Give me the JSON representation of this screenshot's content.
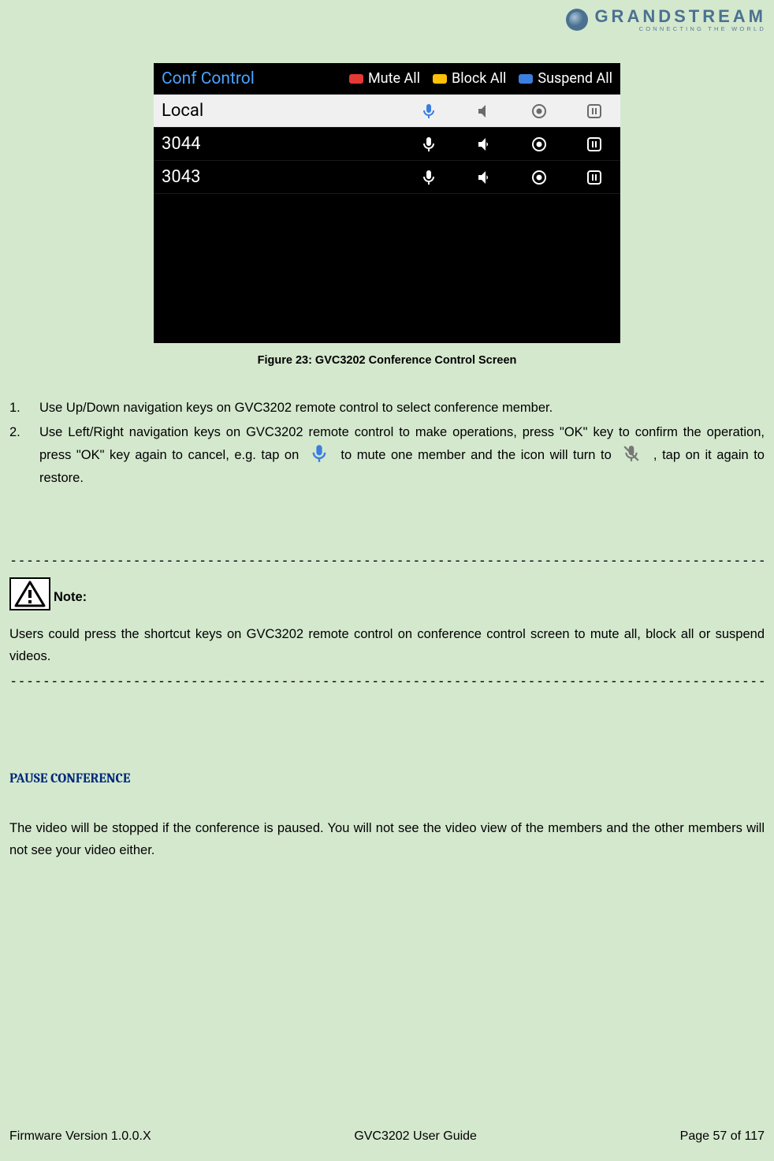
{
  "logo": {
    "name": "GRANDSTREAM",
    "tagline": "CONNECTING THE WORLD"
  },
  "screenshot": {
    "title": "Conf Control",
    "legend": {
      "mute": "Mute All",
      "block": "Block All",
      "suspend": "Suspend All"
    },
    "rows": [
      {
        "label": "Local",
        "selected": true
      },
      {
        "label": "3044",
        "selected": false
      },
      {
        "label": "3043",
        "selected": false
      }
    ]
  },
  "figure_caption": "Figure 23: GVC3202 Conference Control Screen",
  "instructions": {
    "item1_num": "1.",
    "item1": "Use Up/Down navigation keys on GVC3202 remote control to select conference member.",
    "item2_num": "2.",
    "item2_a": "Use Left/Right navigation keys on GVC3202 remote control to make operations, press \"OK\" key to confirm the operation, press \"OK\" key again to cancel, e.g. tap on ",
    "item2_b": " to mute one member and the icon will turn to ",
    "item2_c": " , tap on it again to restore."
  },
  "separator": "--------------------------------------------------------------------------------------------------------------------------------------------",
  "note": {
    "label": "Note:",
    "text": "Users could press the shortcut keys on GVC3202 remote control on conference control screen to mute all, block all or suspend videos."
  },
  "section": {
    "heading": "PAUSE CONFERENCE",
    "body": "The video will be stopped if the conference is paused. You will not see the video view of the members and the other members will not see your video either."
  },
  "footer": {
    "left": "Firmware Version 1.0.0.X",
    "center": "GVC3202 User Guide",
    "right": "Page 57 of 117"
  }
}
